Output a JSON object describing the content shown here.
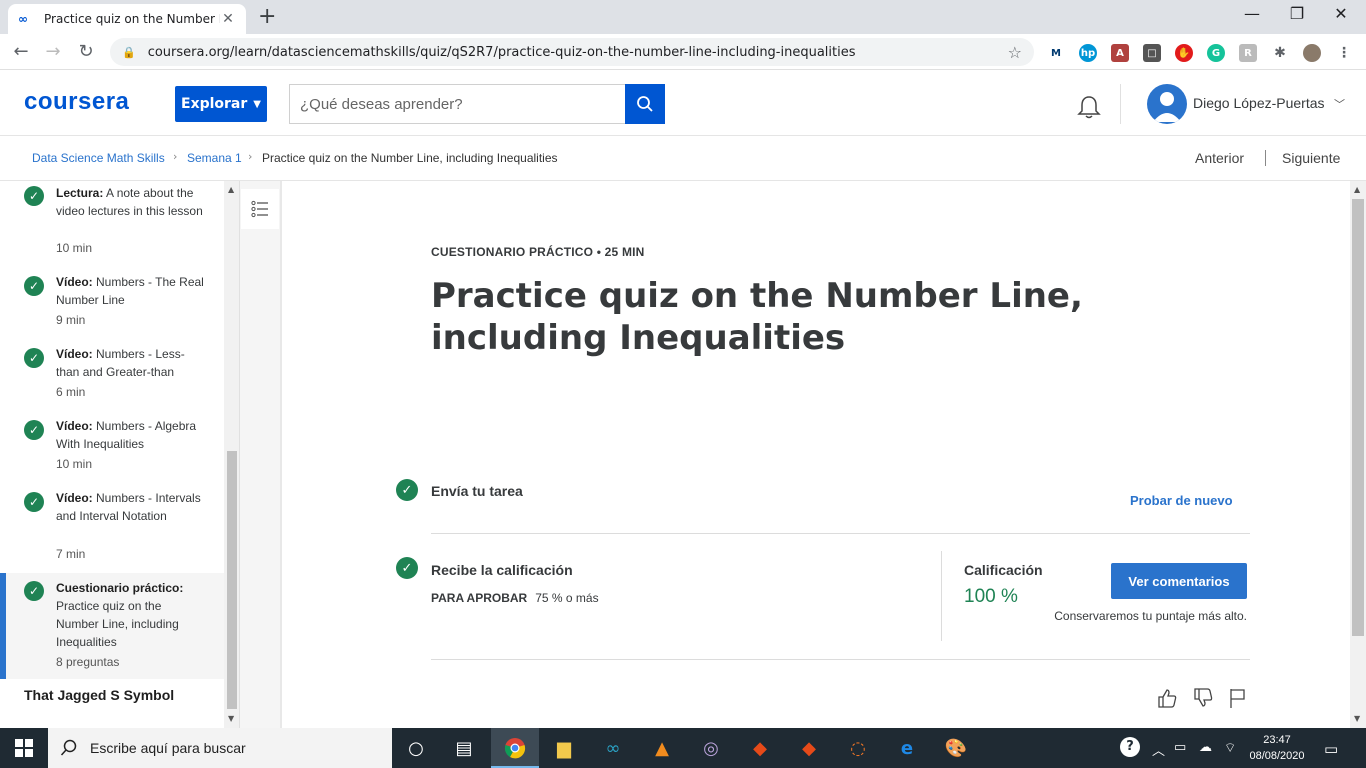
{
  "browser": {
    "tab_title": "Practice quiz on the Number Line, including Inequalities",
    "url": "coursera.org/learn/datasciencemathskills/quiz/qS2R7/practice-quiz-on-the-number-line-including-inequalities"
  },
  "header": {
    "logo": "coursera",
    "explore_label": "Explorar",
    "search_placeholder": "¿Qué deseas aprender?",
    "user_name": "Diego López-Puertas"
  },
  "breadcrumb": {
    "course": "Data Science Math Skills",
    "week": "Semana 1",
    "current": "Practice quiz on the Number Line, including Inequalities"
  },
  "pager": {
    "prev": "Anterior",
    "next": "Siguiente"
  },
  "sidebar": {
    "items": [
      {
        "type": "Lectura:",
        "title": "A note about the video lectures in this lesson",
        "meta": "10 min"
      },
      {
        "type": "Vídeo:",
        "title": "Numbers - The Real Number Line",
        "meta": "9 min"
      },
      {
        "type": "Vídeo:",
        "title": "Numbers - Less-than and Greater-than",
        "meta": "6 min"
      },
      {
        "type": "Vídeo:",
        "title": "Numbers - Algebra With Inequalities",
        "meta": "10 min"
      },
      {
        "type": "Vídeo:",
        "title": "Numbers - Intervals and Interval Notation",
        "meta": "7 min"
      },
      {
        "type": "Cuestionario práctico:",
        "title": "Practice quiz on the Number Line, including Inequalities",
        "meta": "8 preguntas"
      }
    ],
    "next_section": "That Jagged S Symbol"
  },
  "quiz": {
    "kicker": "CUESTIONARIO PRÁCTICO • 25 MIN",
    "title": "Practice quiz on the Number Line, including Inequalities",
    "step1_label": "Envía tu tarea",
    "retry_label": "Probar de nuevo",
    "step2_label": "Recibe la calificación",
    "pass_label": "PARA APROBAR",
    "pass_value": "75 % o más",
    "grade_label": "Calificación",
    "grade_value": "100 %",
    "feedback_label": "Ver comentarios",
    "keep_note": "Conservaremos tu puntaje más alto."
  },
  "taskbar": {
    "search_placeholder": "Escribe aquí para buscar",
    "time": "23:47",
    "date": "08/08/2020"
  },
  "colors": {
    "brand": "#0056d2",
    "link": "#2a73cc",
    "success": "#1f8354"
  }
}
